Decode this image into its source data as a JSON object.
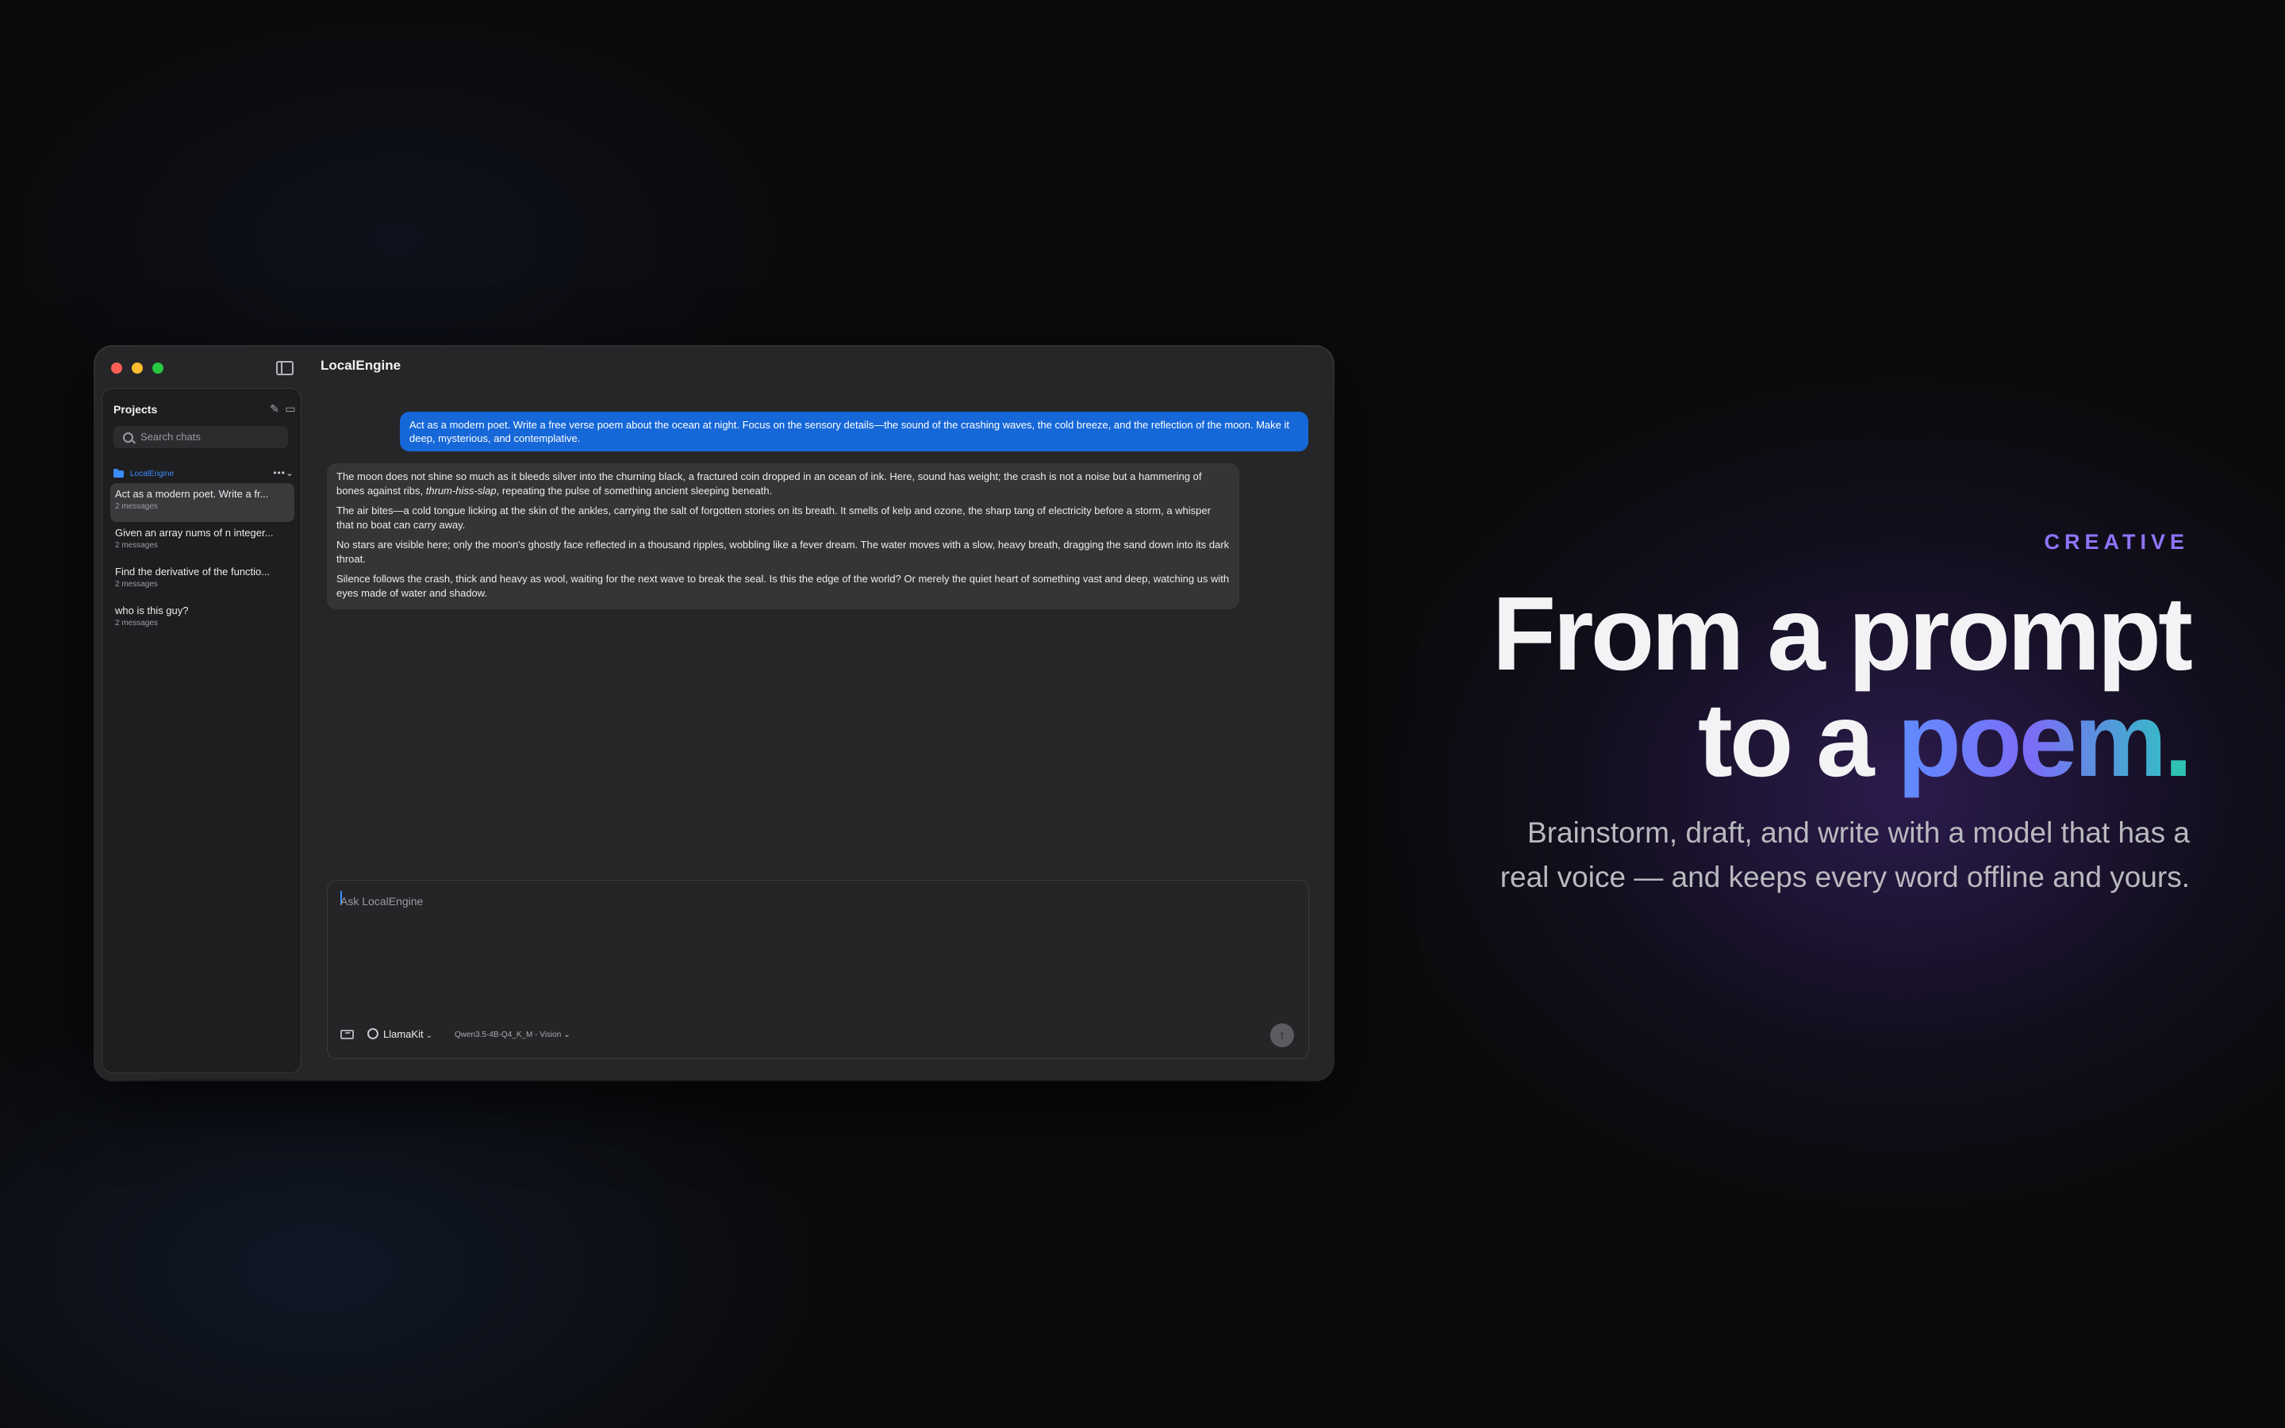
{
  "window": {
    "title": "LocalEngine"
  },
  "sidebar": {
    "heading": "Projects",
    "search_placeholder": "Search chats",
    "folder": {
      "name": "LocalEngine",
      "actions": "•••⌄"
    },
    "chats": [
      {
        "title": "Act as a modern poet. Write a fr...",
        "meta": "2 messages",
        "active": true
      },
      {
        "title": "Given an array nums of n integer...",
        "meta": "2 messages",
        "active": false
      },
      {
        "title": "Find the derivative of the functio...",
        "meta": "2 messages",
        "active": false
      },
      {
        "title": "who is this guy?",
        "meta": "2 messages",
        "active": false
      }
    ]
  },
  "conversation": {
    "user_message": "Act as a modern poet. Write a free verse poem about the ocean at night. Focus on the sensory details—the sound of the crashing waves, the cold breeze, and the reflection of the moon. Make it deep, mysterious, and contemplative.",
    "assistant_paragraphs": {
      "p1_a": "The moon does not shine so much as it bleeds silver into the churning black, a fractured coin dropped in an ocean of ink. Here, sound has weight; the crash is not a noise but a hammering of bones against ribs, ",
      "p1_em": "thrum-hiss-slap",
      "p1_b": ", repeating the pulse of something ancient sleeping beneath.",
      "p2": "The air bites—a cold tongue licking at the skin of the ankles, carrying the salt of forgotten stories on its breath. It smells of kelp and ozone, the sharp tang of electricity before a storm, a whisper that no boat can carry away.",
      "p3": "No stars are visible here; only the moon's ghostly face reflected in a thousand ripples, wobbling like a fever dream. The water moves with a slow, heavy breath, dragging the sand down into its dark throat.",
      "p4": "Silence follows the crash, thick and heavy as wool, waiting for the next wave to break the seal. Is this the edge of the world? Or merely the quiet heart of something vast and deep, watching us with eyes made of water and shadow."
    }
  },
  "composer": {
    "placeholder": "Ask LocalEngine",
    "provider": "LlamaKit",
    "model": "Qwen3.5-4B-Q4_K_M - Vision",
    "send_glyph": "↑"
  },
  "marketing": {
    "eyebrow": "CREATIVE",
    "headline_line1": "From a prompt",
    "headline_line2_prefix": "to a ",
    "headline_highlight": "poem",
    "headline_period": ".",
    "subcopy_line1": "Brainstorm, draft, and write with a model that has a",
    "subcopy_line2": "real voice — and keeps every word offline and yours."
  },
  "colors": {
    "accent_blue": "#1668d8",
    "eyebrow_purple": "#8f74ff",
    "gradient": [
      "#5f8dff",
      "#7c6cf7",
      "#38b8c8"
    ]
  }
}
